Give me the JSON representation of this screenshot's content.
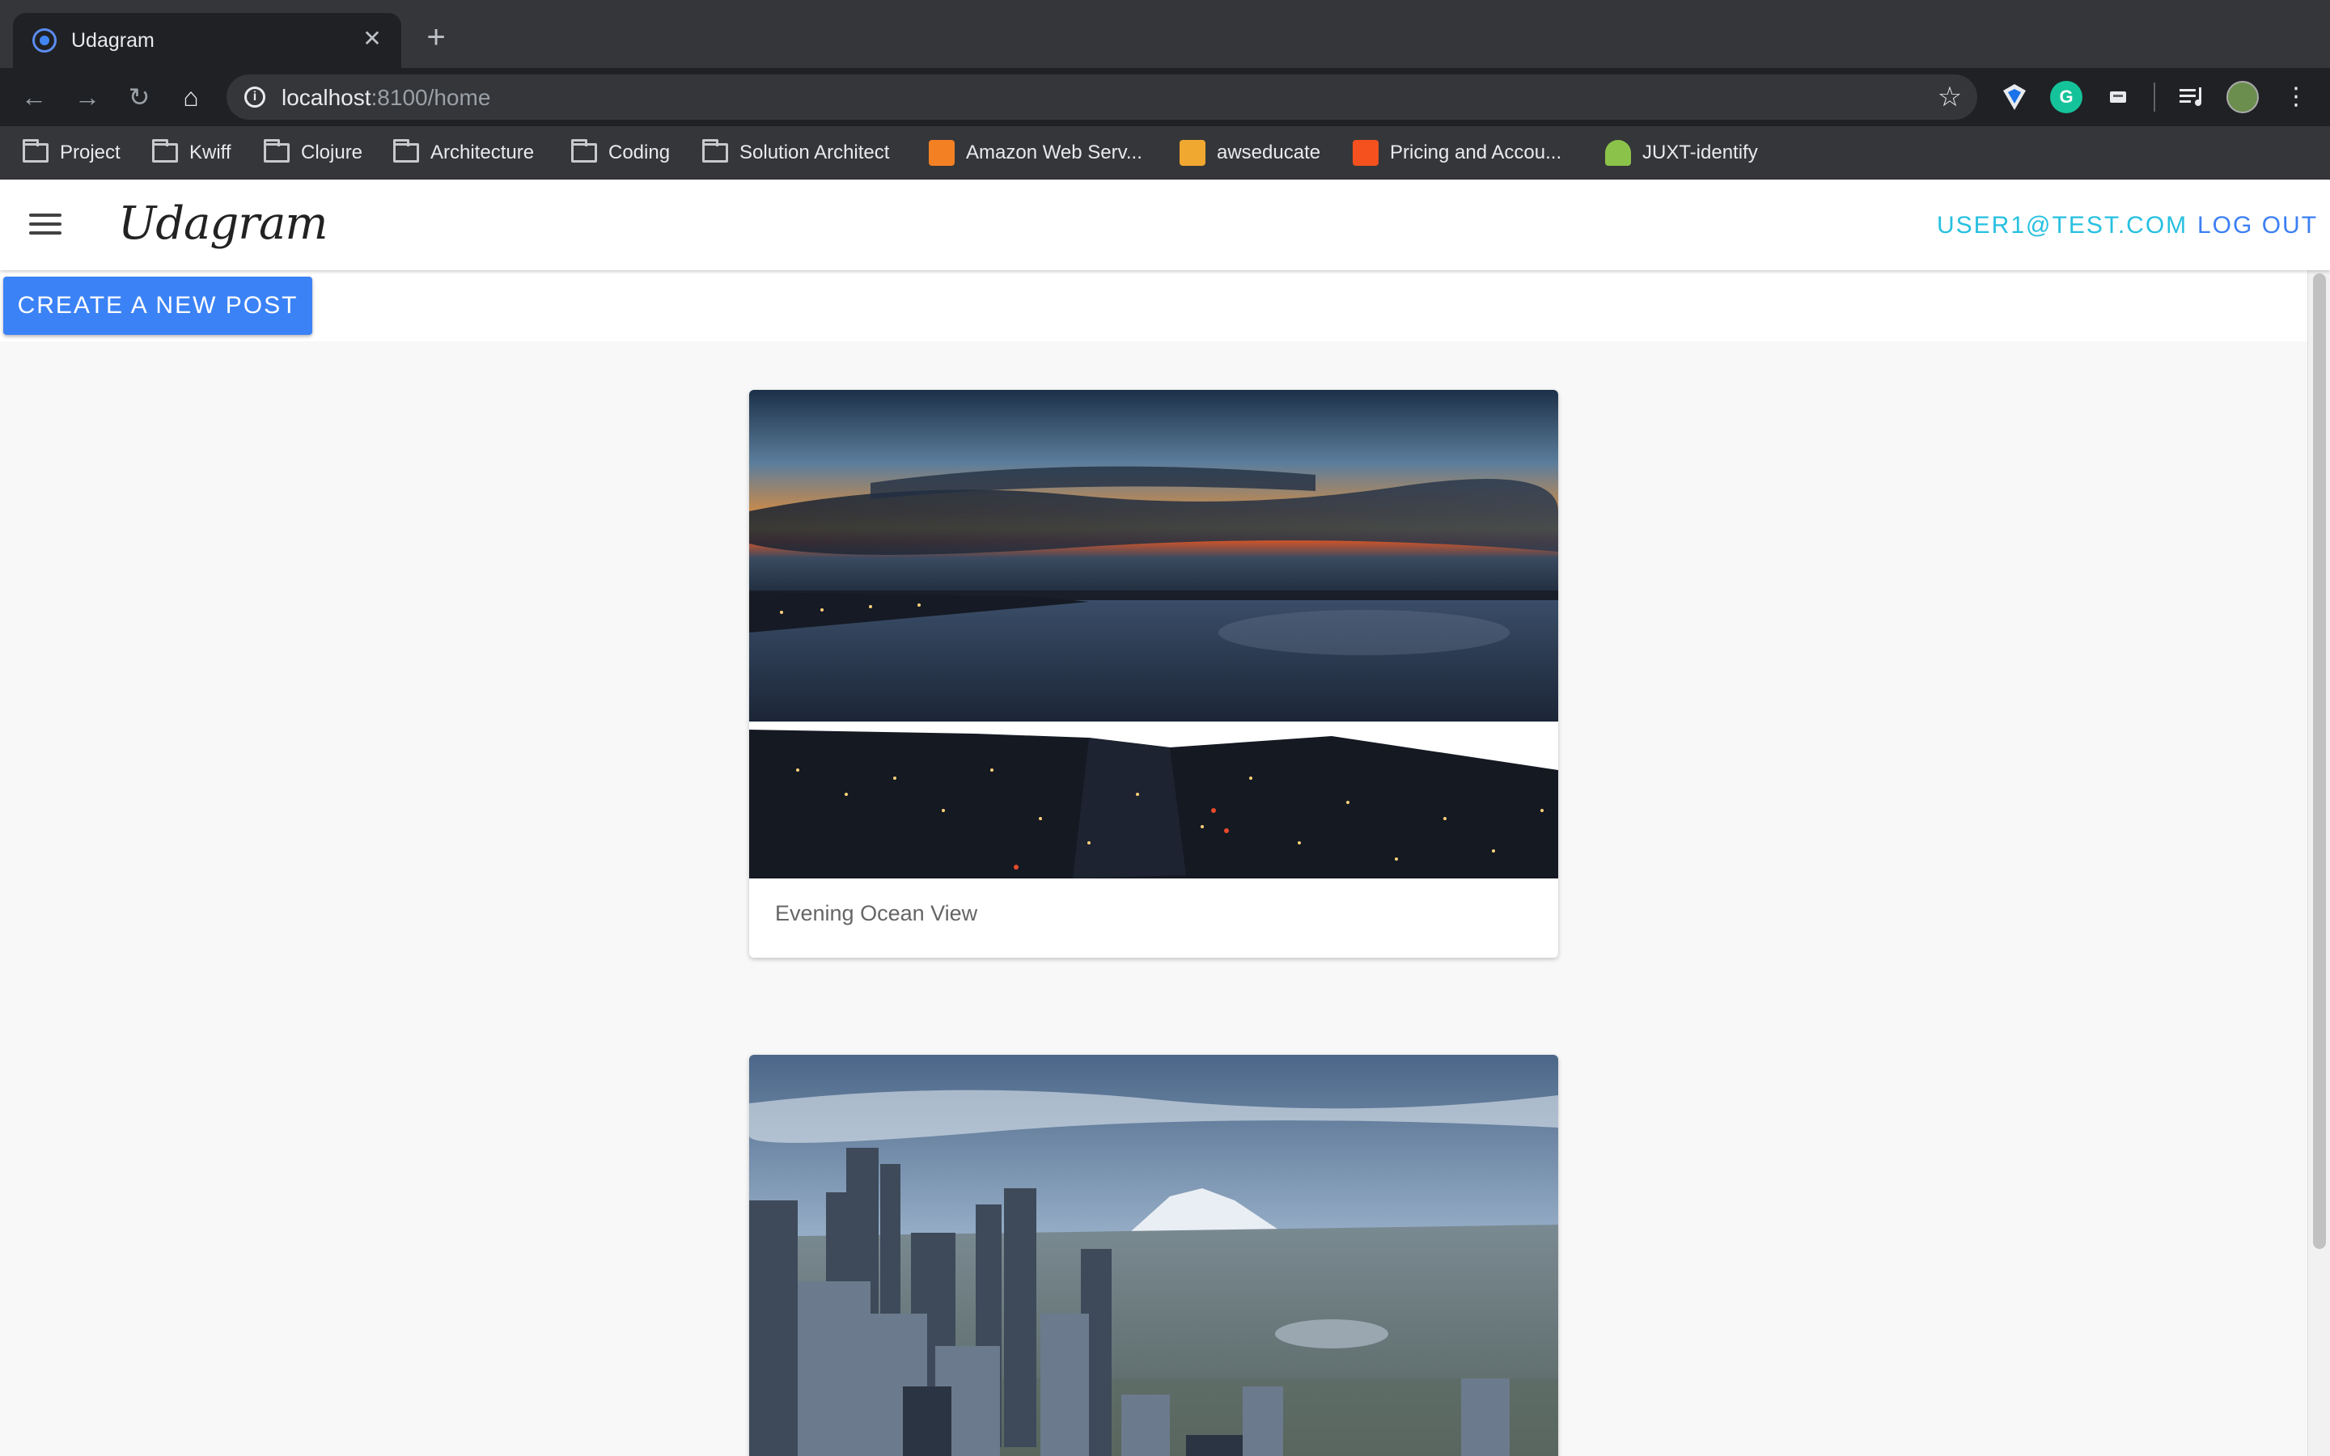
{
  "browser": {
    "tab": {
      "title": "Udagram",
      "favicon": "ionic-icon",
      "close": "✕"
    },
    "new_tab": "+",
    "toolbar": {
      "back": "←",
      "forward": "→",
      "reload": "↻",
      "home": "⌂"
    },
    "omnibox": {
      "host": "localhost",
      "rest": ":8100/home",
      "info": "i",
      "star": "☆"
    },
    "bookmarks": [
      {
        "label": "Project",
        "icon": "folder-icon"
      },
      {
        "label": "Kwiff",
        "icon": "folder-icon"
      },
      {
        "label": "Clojure",
        "icon": "folder-icon"
      },
      {
        "label": "Architecture",
        "icon": "folder-icon"
      },
      {
        "label": "Coding",
        "icon": "folder-icon"
      },
      {
        "label": "Solution Architect",
        "icon": "folder-icon"
      },
      {
        "label": "Amazon Web Serv...",
        "icon": "aws-cube-icon",
        "color": "#f48024"
      },
      {
        "label": "awseducate",
        "icon": "aws-box-icon",
        "color": "#f0a830"
      },
      {
        "label": "Pricing and Accou...",
        "icon": "pricing-icon",
        "color": "#f4511e"
      },
      {
        "label": "JUXT-identify",
        "icon": "thumb-icon",
        "color": "#8bc34a"
      }
    ]
  },
  "app": {
    "logo": "Udagram",
    "user_email": "USER1@TEST.COM",
    "logout_label": "LOG OUT",
    "create_post_label": "CREATE A NEW POST",
    "accent_colors": {
      "primary": "#3b82f6",
      "secondary": "#27c0e0"
    }
  },
  "feed": [
    {
      "caption": "Evening Ocean View",
      "image": "evening-ocean-image"
    },
    {
      "caption": "",
      "image": "city-skyline-image"
    }
  ]
}
